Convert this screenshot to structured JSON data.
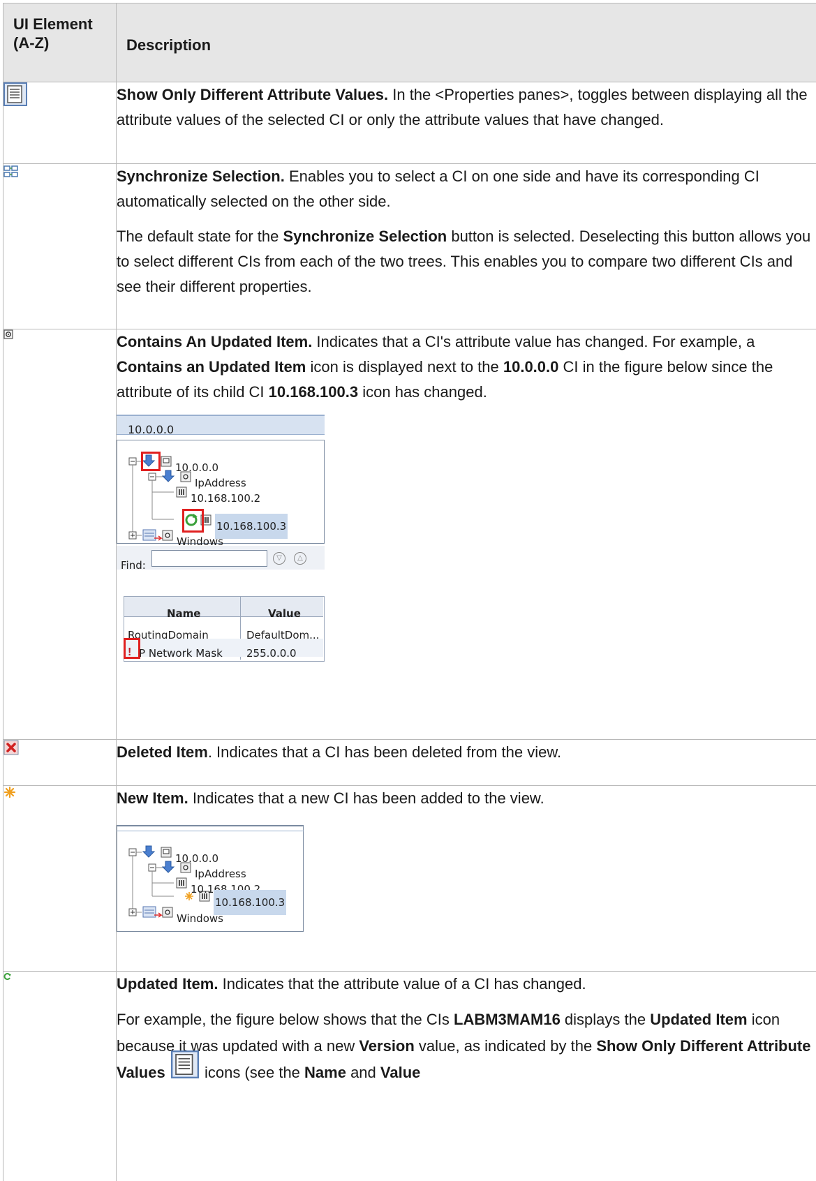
{
  "header": {
    "col1": "UI Element (A-Z)",
    "col1_line1": "UI Element",
    "col1_line2": "(A-Z)",
    "col2": "Description"
  },
  "rows": [
    {
      "icon": "show-only-different-attribute-values-icon",
      "title": "Show Only Different Attribute Values.",
      "text": " In the <Properties panes>, toggles between displaying all the attribute values of the selected CI or only the attribute values that have changed."
    },
    {
      "icon": "synchronize-selection-icon",
      "title": "Synchronize Selection.",
      "text": " Enables you to select a CI on one side and have its corresponding CI automatically selected on the other side.",
      "p2_a": "The default state for the ",
      "p2_b": "Synchronize Selection",
      "p2_c": " button is selected. Deselecting this button allows you to select different CIs from each of the two trees. This enables you to compare two different CIs and see their different properties."
    },
    {
      "icon": "contains-updated-item-icon",
      "title": "Contains An Updated Item.",
      "t1": " Indicates that a CI's attribute value has changed. For example, a ",
      "t2": "Contains an Updated Item",
      "t3": " icon is displayed next to the ",
      "t4": "10.0.0.0",
      "t5": " CI in the figure below since the attribute of its child CI ",
      "t6": "10.168.100.3",
      "t7": " icon has changed.",
      "figure": {
        "panel_title": "10.0.0.0",
        "tree": [
          "10.0.0.0",
          "IpAddress",
          "10.168.100.2",
          "10.168.100.3",
          "Windows"
        ],
        "find_label": "Find:",
        "table_headers": [
          "Name",
          "Value"
        ],
        "table_rows": [
          [
            "RoutingDomain",
            "DefaultDom..."
          ],
          [
            "IP Network Mask",
            "255.0.0.0"
          ]
        ],
        "mask_text": "P Network Mask"
      }
    },
    {
      "icon": "deleted-item-icon",
      "title": "Deleted Item",
      "text": ". Indicates that a CI has been deleted from the view."
    },
    {
      "icon": "new-item-icon",
      "title": "New Item.",
      "text": " Indicates that a new CI has been added to the view.",
      "figure": {
        "tree": [
          "10.0.0.0",
          "IpAddress",
          "10.168.100.2",
          "10.168.100.3",
          "Windows"
        ]
      }
    },
    {
      "icon": "updated-item-icon",
      "title": "Updated Item.",
      "text": " Indicates that the attribute value of a CI has changed.",
      "p2_a": "For example, the figure below shows that the CIs ",
      "p2_b": "LABM3MAM16",
      "p2_c": " displays the ",
      "p2_d": "Updated Item",
      "p2_e": " icon because it was updated with a new ",
      "p2_f": "Version",
      "p2_g": " value, as indicated by the ",
      "p2_h": "Show Only Different Attribute Values",
      "p2_i": " icons (see the ",
      "p2_j": "Name",
      "p2_k": " and ",
      "p2_l": "Value"
    }
  ],
  "colors": {
    "header_bg": "#e6e6e6",
    "border": "#b8b8b8",
    "highlight_red": "#e02020",
    "selection_blue": "#c8d8ec"
  }
}
